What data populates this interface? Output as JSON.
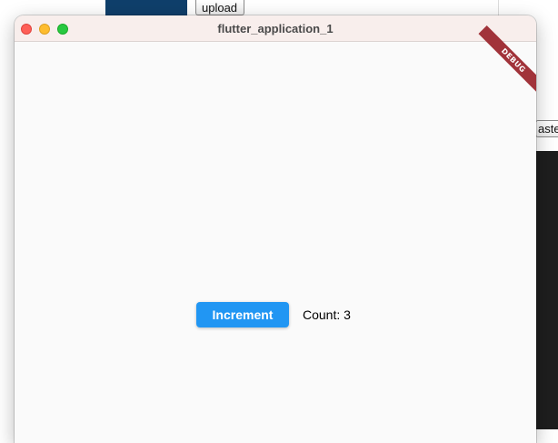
{
  "background_app": {
    "upload_label": "upload",
    "paste_label": "aste"
  },
  "window": {
    "title": "flutter_application_1",
    "debug_banner": "DEBUG"
  },
  "counter": {
    "button_label": "Increment",
    "count_text": "Count: 3"
  },
  "colors": {
    "accent": "#2196f3",
    "debug_banner": "#a1333a",
    "titlebar": "#f8eeec",
    "close": "#fe5f57",
    "minimize": "#febc2e",
    "maximize": "#28c840"
  }
}
